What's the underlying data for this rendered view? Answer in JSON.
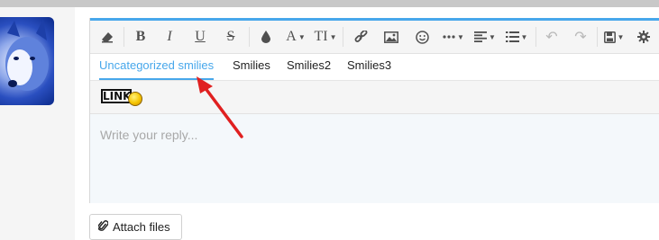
{
  "toolbar": {
    "buttons": [
      {
        "name": "eraser-icon",
        "glyph": "⌫"
      },
      {
        "name": "bold-button",
        "glyph": "B"
      },
      {
        "name": "italic-button",
        "glyph": "I"
      },
      {
        "name": "underline-button",
        "glyph": "U"
      },
      {
        "name": "strikethrough-button",
        "glyph": "S"
      },
      {
        "name": "color-drop-icon",
        "glyph": "💧"
      },
      {
        "name": "font-button",
        "glyph": "A▾"
      },
      {
        "name": "text-size-button",
        "glyph": "TI▾"
      },
      {
        "name": "link-icon",
        "glyph": "🔗"
      },
      {
        "name": "image-icon",
        "glyph": "🖼"
      },
      {
        "name": "smiley-icon",
        "glyph": "☺"
      },
      {
        "name": "more-button",
        "glyph": "•••▾"
      },
      {
        "name": "align-button",
        "glyph": "≡▾"
      },
      {
        "name": "list-button",
        "glyph": "☰▾"
      },
      {
        "name": "undo-icon",
        "glyph": "↶"
      },
      {
        "name": "redo-icon",
        "glyph": "↷"
      },
      {
        "name": "save-drafts-button",
        "glyph": "💾▾"
      },
      {
        "name": "gear-icon",
        "glyph": "⚙"
      }
    ]
  },
  "tabs": [
    {
      "label": "Uncategorized smilies",
      "active": true
    },
    {
      "label": "Smilies",
      "active": false
    },
    {
      "label": "Smilies2",
      "active": false
    },
    {
      "label": "Smilies3",
      "active": false
    }
  ],
  "smilie": {
    "text": "LINK",
    "icon": "link-smilie-icon"
  },
  "reply": {
    "placeholder": "Write your reply..."
  },
  "attach": {
    "label": "Attach files",
    "icon": "paperclip-icon"
  },
  "colors": {
    "accent": "#47a7eb",
    "annotation_arrow": "#e02020"
  }
}
